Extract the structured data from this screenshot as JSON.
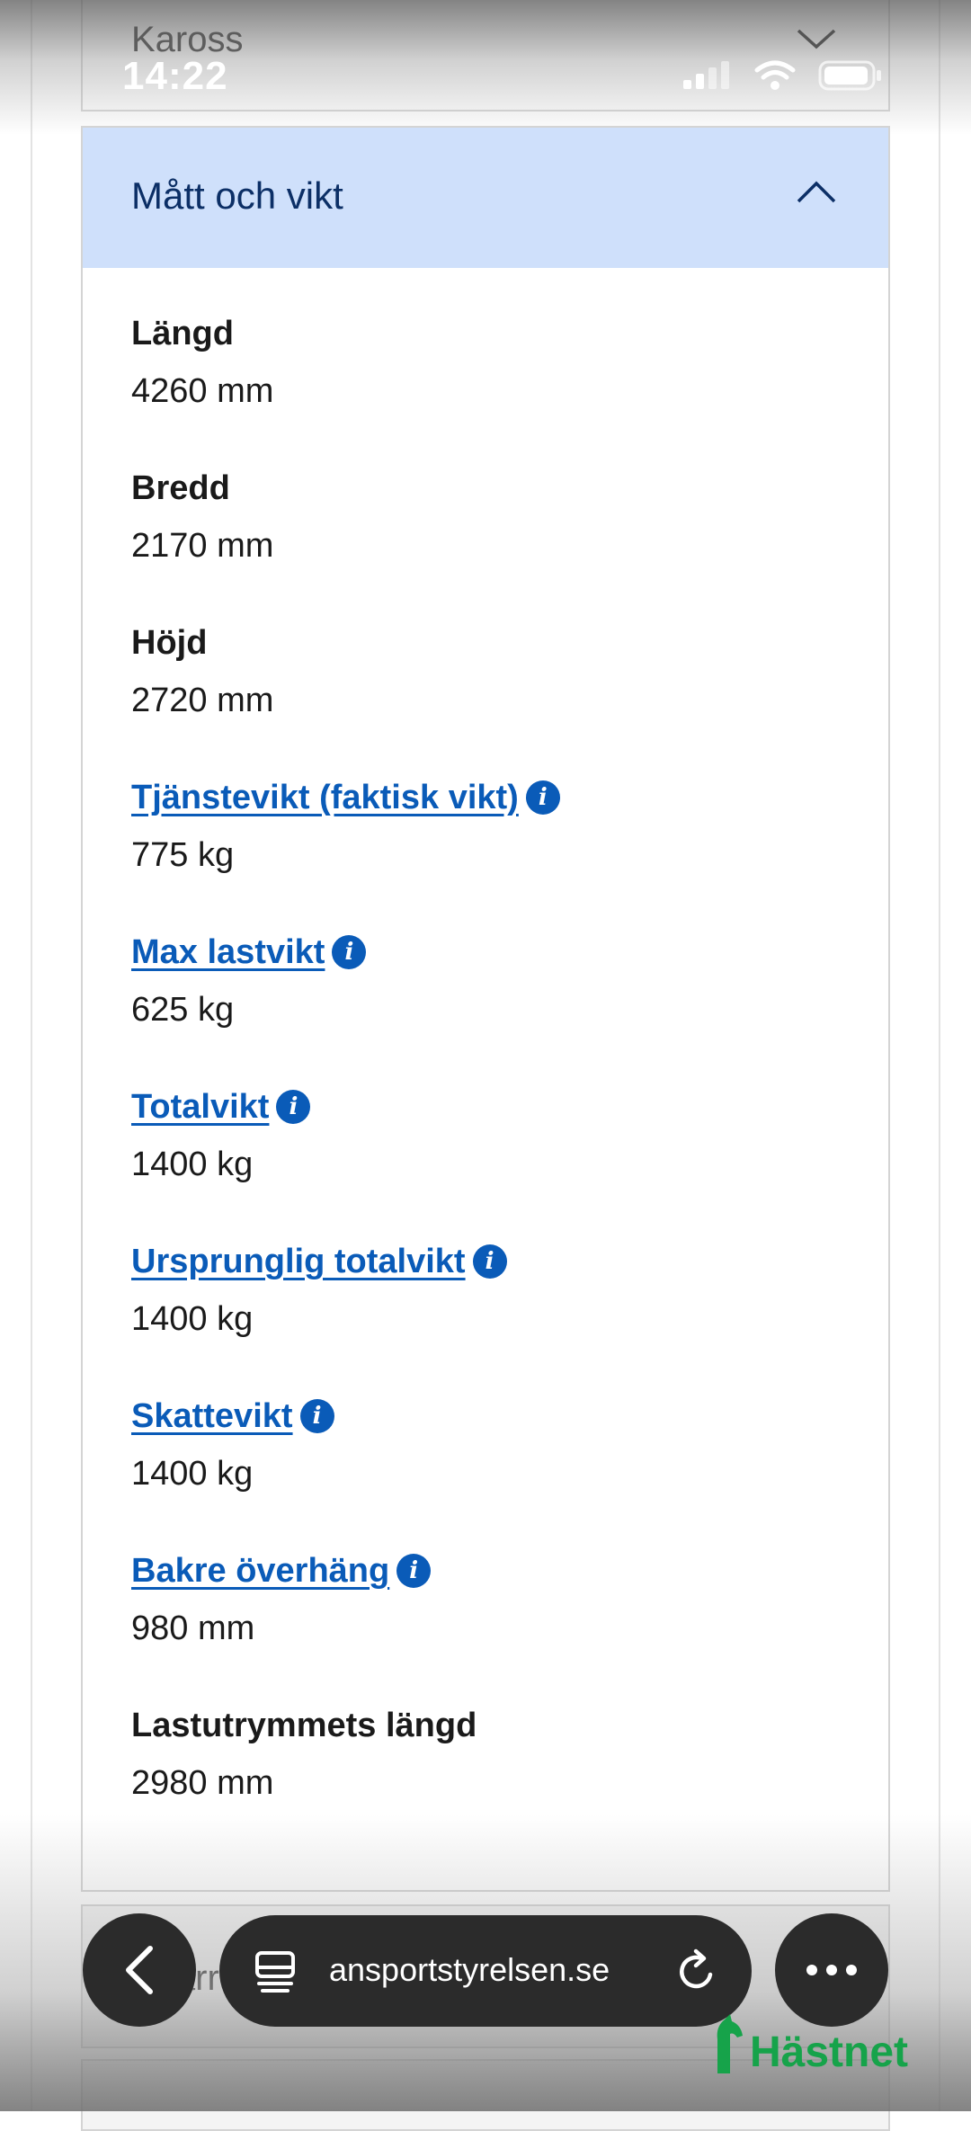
{
  "status_bar": {
    "time": "14:22"
  },
  "accordion_top": {
    "title": "Kaross"
  },
  "accordion_open": {
    "title": "Mått och vikt",
    "items": [
      {
        "label": "Längd",
        "value": "4260 mm",
        "link": false
      },
      {
        "label": "Bredd",
        "value": "2170 mm",
        "link": false
      },
      {
        "label": "Höjd",
        "value": "2720 mm",
        "link": false
      },
      {
        "label": "Tjänstevikt (faktisk vikt)",
        "value": "775 kg",
        "link": true
      },
      {
        "label": "Max lastvikt",
        "value": "625 kg",
        "link": true
      },
      {
        "label": "Totalvikt",
        "value": "1400 kg",
        "link": true
      },
      {
        "label": "Ursprunglig totalvikt",
        "value": "1400 kg",
        "link": true
      },
      {
        "label": "Skattevikt",
        "value": "1400 kg",
        "link": true
      },
      {
        "label": "Bakre överhäng",
        "value": "980 mm",
        "link": true
      },
      {
        "label": "Lastutrymmets längd",
        "value": "2980 mm",
        "link": false
      }
    ],
    "info_glyph": "i"
  },
  "accordion_next": {
    "title": "Sparr"
  },
  "browser": {
    "url": "ansportstyrelsen.se"
  },
  "watermark": {
    "text": "Hästnet"
  },
  "colors": {
    "link": "#0a5bb8",
    "header_bg": "#cfe0fb",
    "header_text": "#0c2f66",
    "brand": "#16a34a"
  }
}
